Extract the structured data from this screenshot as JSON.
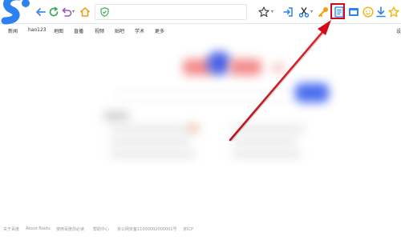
{
  "toolbar": {
    "address_value": "",
    "icons": [
      "back-arrow-icon",
      "refresh-icon",
      "undo-icon",
      "home-icon",
      "shield-icon",
      "star-icon",
      "login-icon",
      "scissors-icon",
      "key-icon",
      "reading-mode-icon",
      "window-icon",
      "emoji-icon",
      "download-icon",
      "favorites-star-icon"
    ],
    "accent_color": "#1e90ff",
    "highlight_color": "#d10b17"
  },
  "nav": {
    "items": [
      "新闻",
      "hao123",
      "地图",
      "直播",
      "视频",
      "贴吧",
      "学术",
      "更多"
    ],
    "right_label": "设"
  },
  "footer": {
    "items": [
      "关于百度",
      "About Baidu",
      "使用百度前必读",
      "帮助中心",
      "京公网安备11000002000001号",
      "京ICP"
    ]
  }
}
